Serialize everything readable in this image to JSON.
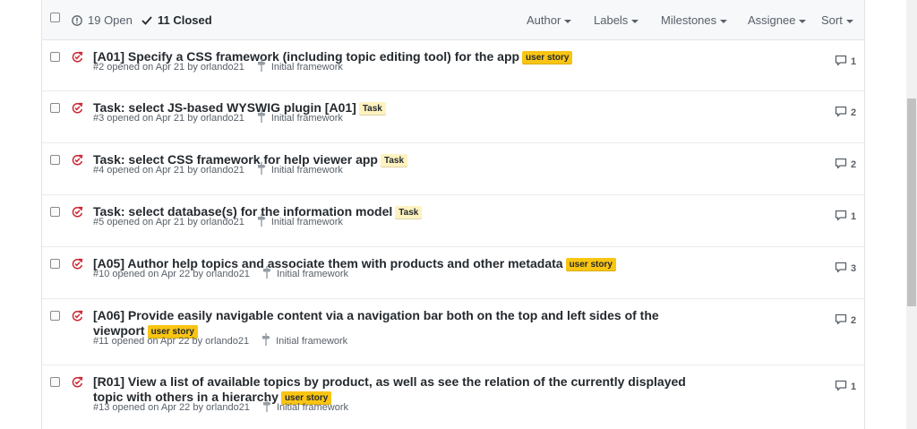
{
  "header": {
    "open_label": "19 Open",
    "closed_label": "11 Closed",
    "filters": [
      "Author",
      "Labels",
      "Milestones",
      "Assignee",
      "Sort"
    ]
  },
  "colors": {
    "user_story": "#f9c513",
    "task": "#fef2c0",
    "closed_icon": "#cb2431"
  },
  "issues": [
    {
      "title": "[A01] Specify a CSS framework (including topic editing tool) for the app",
      "label": "user story",
      "meta": "#2 opened on Apr 21 by orlando21",
      "milestone": "Initial framework",
      "comments": "1"
    },
    {
      "title": "Task: select JS-based WYSWIG plugin [A01]",
      "label": "Task",
      "meta": "#3 opened on Apr 21 by orlando21",
      "milestone": "Initial framework",
      "comments": "2"
    },
    {
      "title": "Task: select CSS framework for help viewer app",
      "label": "Task",
      "meta": "#4 opened on Apr 21 by orlando21",
      "milestone": "Initial framework",
      "comments": "2"
    },
    {
      "title": "Task: select database(s) for the information model",
      "label": "Task",
      "meta": "#5 opened on Apr 21 by orlando21",
      "milestone": "Initial framework",
      "comments": "1"
    },
    {
      "title": "[A05] Author help topics and associate them with products and other metadata",
      "label": "user story",
      "meta": "#10 opened on Apr 22 by orlando21",
      "milestone": "Initial framework",
      "comments": "3"
    },
    {
      "title": "[A06] Provide easily navigable content via a navigation bar both on the top and left sides of the viewport",
      "label": "user story",
      "meta": "#11 opened on Apr 22 by orlando21",
      "milestone": "Initial framework",
      "comments": "2"
    },
    {
      "title": "[R01] View a list of available topics by product, as well as see the relation of the currently displayed topic with others in a hierarchy",
      "label": "user story",
      "meta": "#13 opened on Apr 22 by orlando21",
      "milestone": "Initial framework",
      "comments": "1"
    }
  ]
}
